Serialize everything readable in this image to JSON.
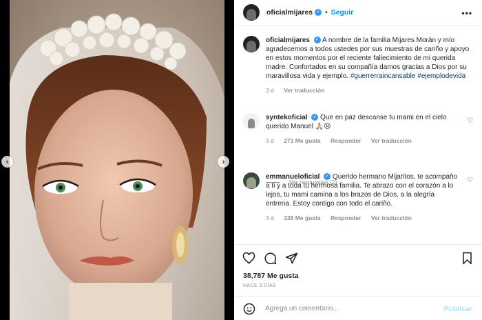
{
  "post": {
    "username": "oficialmijares",
    "follow_label": "Seguir",
    "more_label": "•••"
  },
  "caption": {
    "username": "oficialmijares",
    "text": "A nombre de la familia Mijares Morán y mío agradecemos a todos ustedes por sus muestras de cariño y apoyo en estos momentos por el reciente fallecimiento de mi querida madre. Confortados en su compañía damos gracias a Dios por su maravillosa vida y ejemplo.",
    "hashtag_1": "#guerrerraincansable",
    "hashtag_2": "#ejemplodevida",
    "time": "3 d",
    "translate": "Ver traducción"
  },
  "comments": [
    {
      "username": "syntekoficial",
      "text": "Que en paz descanse tu mami en el cielo querido Manuel 🙏🏼😢",
      "time": "3 d",
      "likes": "271 Me gusta",
      "reply": "Responder",
      "translate": "Ver traducción",
      "replies": "Ver respuestas (2)"
    },
    {
      "username": "emmanueloficial",
      "text": "Querido hermano Mijaritos, te acompaño a ti y a toda tu hermosa familia. Te abrazo con el corazón a lo lejos, tu mami camina a los brazos de Dios, a la alegría entrena. Estoy contigo con todo el cariño.",
      "time": "3 d",
      "likes": "338 Me gusta",
      "reply": "Responder",
      "translate": "Ver traducción"
    }
  ],
  "stats": {
    "likes": "38,787 Me gusta",
    "date": "HACE 3 DÍAS"
  },
  "composer": {
    "placeholder": "Agrega un comentario...",
    "publish": "Publicar"
  },
  "colors": {
    "accent": "#0095f6",
    "verified": "#3897f0",
    "hashtag": "#00376b",
    "muted": "#8e8e8e"
  }
}
